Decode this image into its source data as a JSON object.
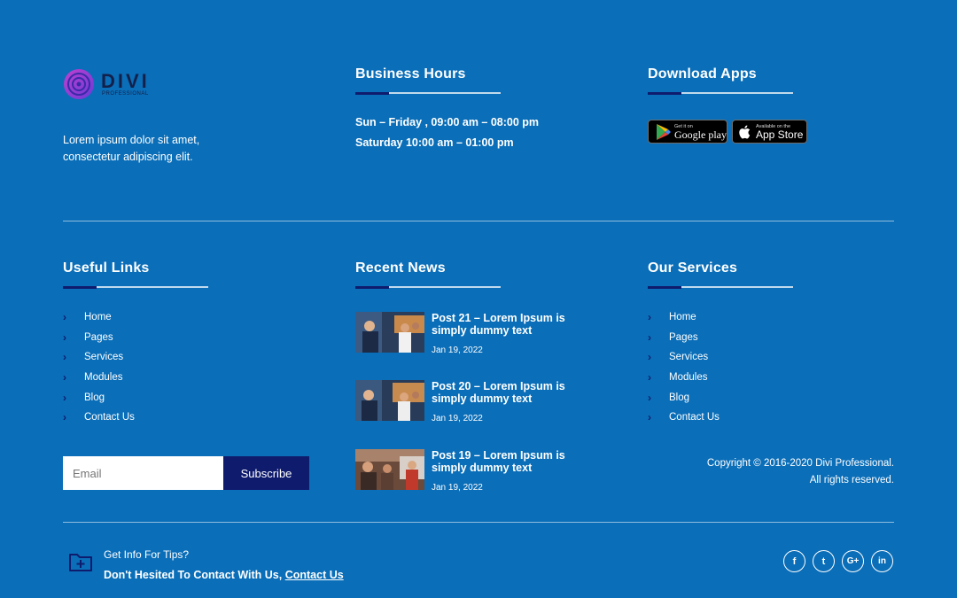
{
  "brand": {
    "name": "DIVI",
    "tagline": "PROFESSIONAL",
    "description_line1": "Lorem ipsum dolor sit amet,",
    "description_line2": "consectetur adipiscing elit."
  },
  "business_hours": {
    "title": "Business Hours",
    "line1": "Sun – Friday , 09:00 am – 08:00 pm",
    "line2": "Saturday 10:00 am – 01:00 pm"
  },
  "download_apps": {
    "title": "Download Apps",
    "google_play": {
      "small": "Get it on",
      "big": "Google play"
    },
    "app_store": {
      "small": "Available on the",
      "big": "App Store"
    }
  },
  "useful_links": {
    "title": "Useful Links",
    "items": [
      "Home",
      "Pages",
      "Services",
      "Modules",
      "Blog",
      "Contact Us"
    ]
  },
  "recent_news": {
    "title": "Recent News",
    "items": [
      {
        "title": "Post 21 – Lorem Ipsum is simply dummy text",
        "date": "Jan 19, 2022"
      },
      {
        "title": "Post 20 – Lorem Ipsum is simply dummy text",
        "date": "Jan 19, 2022"
      },
      {
        "title": "Post 19 – Lorem Ipsum is simply dummy text",
        "date": "Jan 19, 2022"
      }
    ]
  },
  "our_services": {
    "title": "Our Services",
    "items": [
      "Home",
      "Pages",
      "Services",
      "Modules",
      "Blog",
      "Contact Us"
    ]
  },
  "subscribe": {
    "placeholder": "Email",
    "button": "Subscribe"
  },
  "copyright": {
    "line1": "Copyright © 2016-2020 Divi Professional.",
    "line2": "All rights reserved."
  },
  "bottom": {
    "question": "Get Info For Tips?",
    "cta_text": "Don't Hesited To Contact With Us,",
    "cta_link": "Contact Us"
  },
  "social": {
    "facebook": "f",
    "twitter": "t",
    "google": "G+",
    "linkedin": "in"
  },
  "colors": {
    "background": "#0a6eb8",
    "accent_navy": "#0f1c6e",
    "text": "#ffffff"
  }
}
